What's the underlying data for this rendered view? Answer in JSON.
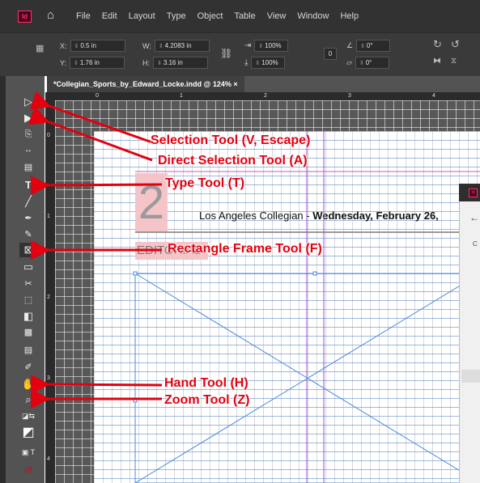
{
  "menubar": {
    "app_badge": "Id",
    "items": [
      "File",
      "Edit",
      "Layout",
      "Type",
      "Object",
      "Table",
      "View",
      "Window",
      "Help"
    ]
  },
  "control": {
    "x_label": "X:",
    "x_value": "0.5 in",
    "y_label": "Y:",
    "y_value": "1.76 in",
    "w_label": "W:",
    "w_value": "4.2083 in",
    "h_label": "H:",
    "h_value": "3.16 in",
    "scale_x": "100%",
    "scale_y": "100%",
    "angle": "0°",
    "shear": "0°",
    "stroke": "0"
  },
  "document": {
    "tab_title": "*Collegian_Sports_by_Edward_Locke.indd @ 124%",
    "close": "×"
  },
  "rulers": {
    "top": [
      "0",
      "1",
      "2",
      "3",
      "4"
    ],
    "side": [
      "0",
      "1",
      "2",
      "3",
      "4"
    ]
  },
  "page": {
    "big_number": "2",
    "headline_plain": "Los Angeles Collegian - ",
    "headline_bold": "Wednesday, February 26,",
    "section": "EDITORIAL"
  },
  "panel": {
    "badge": "Id",
    "arrow": "←",
    "letter": "C"
  },
  "callouts": {
    "selection": "Selection Tool (V, Escape)",
    "direct": "Direct Selection Tool (A)",
    "type": "Type Tool (T)",
    "rectangle": "Rectangle Frame Tool (F)",
    "hand": "Hand Tool (H)",
    "zoom": "Zoom Tool (Z)"
  },
  "colors": {
    "callout": "#e3000f",
    "accent": "#ff3366",
    "chrome": "#323232"
  }
}
